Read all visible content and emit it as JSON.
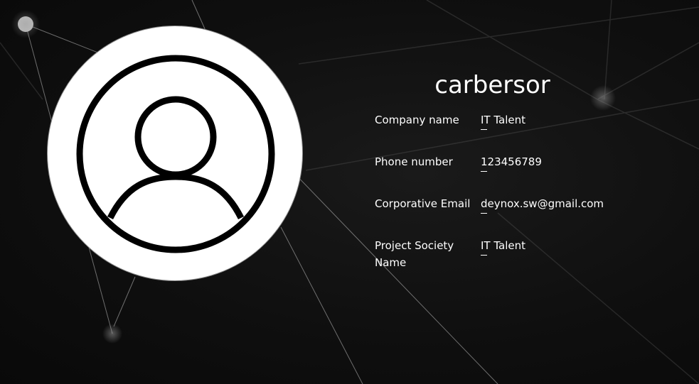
{
  "profile": {
    "username": "carbersor",
    "avatar_icon": "user-icon",
    "fields": [
      {
        "label": "Company name",
        "value": "IT Talent"
      },
      {
        "label": "Phone number",
        "value": "123456789"
      },
      {
        "label": "Corporative Email",
        "value": "deynox.sw@gmail.com"
      },
      {
        "label": "Project Society Name",
        "value": "IT Talent"
      }
    ]
  },
  "colors": {
    "background": "#0d0d0d",
    "text": "#ffffff",
    "avatar_bg": "#ffffff",
    "avatar_stroke": "#000000"
  }
}
